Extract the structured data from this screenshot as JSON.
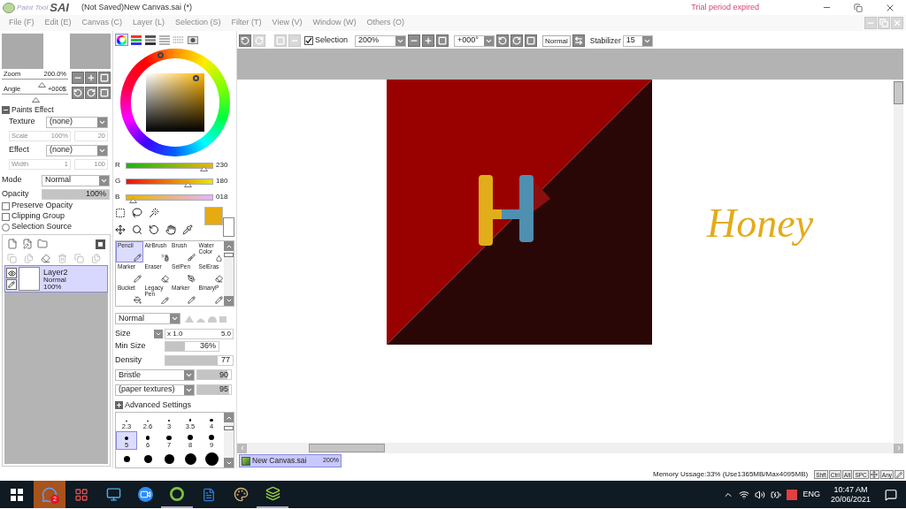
{
  "title_bar": {
    "logo_small": "Paint Tool",
    "logo_large": "SAI",
    "title": "(Not Saved)New Canvas.sai (*)",
    "notice": "Trial period expired"
  },
  "menu": [
    "File (F)",
    "Edit (E)",
    "Canvas (C)",
    "Layer (L)",
    "Selection (S)",
    "Filter (T)",
    "View (V)",
    "Window (W)",
    "Others (O)"
  ],
  "navigator": {
    "zoom": {
      "label": "Zoom",
      "value": "200.0%",
      "level": 0.6
    },
    "angle": {
      "label": "Angle",
      "value": "+000$",
      "level": 0.5
    }
  },
  "paints_effect": {
    "title": "Paints Effect",
    "expanded": true,
    "rows": [
      {
        "kind": "select",
        "label": "Texture",
        "value": "(none)",
        "disabled": false
      },
      {
        "kind": "pair",
        "label": "Scale",
        "value": "100%",
        "value2": "20",
        "disabled": true
      },
      {
        "kind": "select",
        "label": "Effect",
        "value": "(none)",
        "disabled": false
      },
      {
        "kind": "pair",
        "label": "Width",
        "value": "1",
        "value2": "100",
        "disabled": true
      }
    ]
  },
  "layer_props": {
    "mode": {
      "label": "Mode",
      "value": "Normal"
    },
    "opacity": {
      "label": "Opacity",
      "value": "100%",
      "level": 1.0
    },
    "options": [
      {
        "kind": "checkbox",
        "label": "Preserve Opacity",
        "checked": false
      },
      {
        "kind": "checkbox",
        "label": "Clipping Group",
        "checked": false
      },
      {
        "kind": "radio",
        "label": "Selection Source",
        "checked": false
      }
    ]
  },
  "layers": [
    {
      "name": "Layer2",
      "mode": "Normal",
      "opacity": "100%",
      "selected": true,
      "visible": true
    }
  ],
  "color_tabs": [
    {
      "kind": "wheel",
      "selected": true
    },
    {
      "kind": "rgb",
      "selected": false
    },
    {
      "kind": "hsv",
      "selected": false
    },
    {
      "kind": "swatches",
      "selected": false
    },
    {
      "kind": "palette",
      "selected": false
    },
    {
      "kind": "scratchpad",
      "selected": false
    }
  ],
  "rgb": [
    {
      "label": "R",
      "value": "230",
      "level": 0.9
    },
    {
      "label": "G",
      "value": "180",
      "level": 0.71
    },
    {
      "label": "B",
      "value": "018",
      "level": 0.07
    }
  ],
  "swatches": [
    {
      "color": "#e6aa12"
    },
    {
      "color": "#ffffff"
    }
  ],
  "tools": [
    {
      "label": "Pencil",
      "kind": "pencil",
      "selected": true
    },
    {
      "label": "AirBrush",
      "kind": "spray",
      "selected": false
    },
    {
      "label": "Brush",
      "kind": "brush",
      "selected": false
    },
    {
      "label": "Water Color",
      "kind": "drop",
      "selected": false
    },
    {
      "label": "Marker",
      "kind": "pencil",
      "selected": false
    },
    {
      "label": "Eraser",
      "kind": "eraser",
      "selected": false
    },
    {
      "label": "SelPen",
      "kind": "pen",
      "selected": false
    },
    {
      "label": "SelEras",
      "kind": "eraser",
      "selected": false
    },
    {
      "label": "Bucket",
      "kind": "bucket",
      "selected": false
    },
    {
      "label": "Legacy Pen",
      "kind": "pencil",
      "selected": false
    },
    {
      "label": "Marker",
      "kind": "pencil",
      "selected": false
    },
    {
      "label": "BinaryP",
      "kind": "pencil",
      "selected": false
    }
  ],
  "brush": {
    "mode": "Normal",
    "size": {
      "label": "Size",
      "multiplier": "x 1.0",
      "value": "5.0"
    },
    "min_size": {
      "label": "Min Size",
      "value": "36%",
      "level": 0.36
    },
    "density": {
      "label": "Density",
      "value": "77",
      "level": 0.77
    },
    "shape": {
      "value": "Bristle",
      "reading": "90",
      "level": 0.9
    },
    "texture": {
      "value": "(paper textures)",
      "reading": "95",
      "level": 0.95
    },
    "advanced": {
      "label": "Advanced Settings",
      "expanded": false
    }
  },
  "brush_sizes": [
    {
      "label": "2.3",
      "selected": false
    },
    {
      "label": "2.6",
      "selected": false
    },
    {
      "label": "3",
      "selected": false
    },
    {
      "label": "3.5",
      "selected": false
    },
    {
      "label": "4",
      "selected": false
    },
    {
      "label": "5",
      "selected": true
    },
    {
      "label": "6",
      "selected": false
    },
    {
      "label": "7",
      "selected": false
    },
    {
      "label": "8",
      "selected": false
    },
    {
      "label": "9",
      "selected": false
    }
  ],
  "toolbar": {
    "selection": {
      "label": "Selection",
      "checked": true
    },
    "zoom": "200%",
    "angle": "+000°",
    "blend": "Normal",
    "stabilizer_label": "Stabilizer",
    "stabilizer": "15"
  },
  "canvas": {
    "text": "Honey"
  },
  "document_tabs": [
    {
      "name": "New Canvas.sai",
      "zoom": "200%",
      "selected": true
    }
  ],
  "status_bar": {
    "memory": "Memory Ussage:33% (Use1365MB/Max4095MB)",
    "keys": [
      "Shft",
      "Ctrl",
      "Alt",
      "SPC"
    ],
    "mode_key": "Any"
  },
  "taskbar": {
    "apps": [
      {
        "kind": "messenger",
        "badge": "2",
        "flashing": true,
        "running": false
      },
      {
        "kind": "grid",
        "flashing": false,
        "running": false
      },
      {
        "kind": "computer",
        "flashing": false,
        "running": false
      },
      {
        "kind": "video",
        "flashing": false,
        "running": false
      },
      {
        "kind": "circle",
        "flashing": false,
        "running": true
      },
      {
        "kind": "word",
        "flashing": false,
        "running": false
      },
      {
        "kind": "paint",
        "flashing": false,
        "running": false
      },
      {
        "kind": "sai",
        "flashing": false,
        "running": true
      }
    ],
    "language": "ENG",
    "time": "10:47 AM",
    "date": "20/06/2021"
  }
}
